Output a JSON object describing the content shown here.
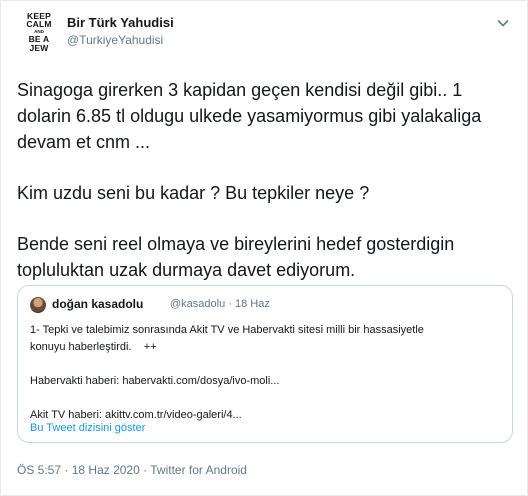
{
  "author": {
    "name": "Bir Türk Yahudisi",
    "handle": "@TurkiyeYahudisi",
    "avatar_lines": [
      "KEEP",
      "CALM",
      "AND",
      "BE A",
      "JEW"
    ]
  },
  "tweet": {
    "paragraphs": [
      "Sinagoga girerken 3 kapidan geçen kendisi değil gibi.. 1 dolarin 6.85 tl oldugu ulkede yasamiyormus gibi yalakaliga devam et cnm ...",
      "Kim uzdu seni bu kadar ? Bu tepkiler neye ?",
      "Bende seni reel olmaya ve bireylerini hedef gosterdigin topluluktan uzak durmaya davet ediyorum."
    ]
  },
  "quoted": {
    "name": "doğan kasadolu",
    "handle": "@kasadolu",
    "date": "18 Haz",
    "line1": "1- Tepki ve talebimiz sonrasında Akit TV ve Habervakti sitesi milli bir hassasiyetle",
    "line2": "konuyu haberleştirdi.",
    "line2_suffix": "++",
    "line3": "Habervakti haberi: habervakti.com/dosya/ivo-moli...",
    "line4": "Akit TV haberi: akittv.com.tr/video-galeri/4...",
    "show_thread": "Bu Tweet dizisini göster"
  },
  "footer": {
    "time": "ÖS 5:57",
    "date": "18 Haz 2020",
    "separator": "·",
    "app": "Twitter for Android"
  },
  "icons": {
    "menu": "chevron-down-icon"
  },
  "colors": {
    "link": "#1b95e0",
    "muted": "#657786",
    "border": "#ccd6dd"
  }
}
